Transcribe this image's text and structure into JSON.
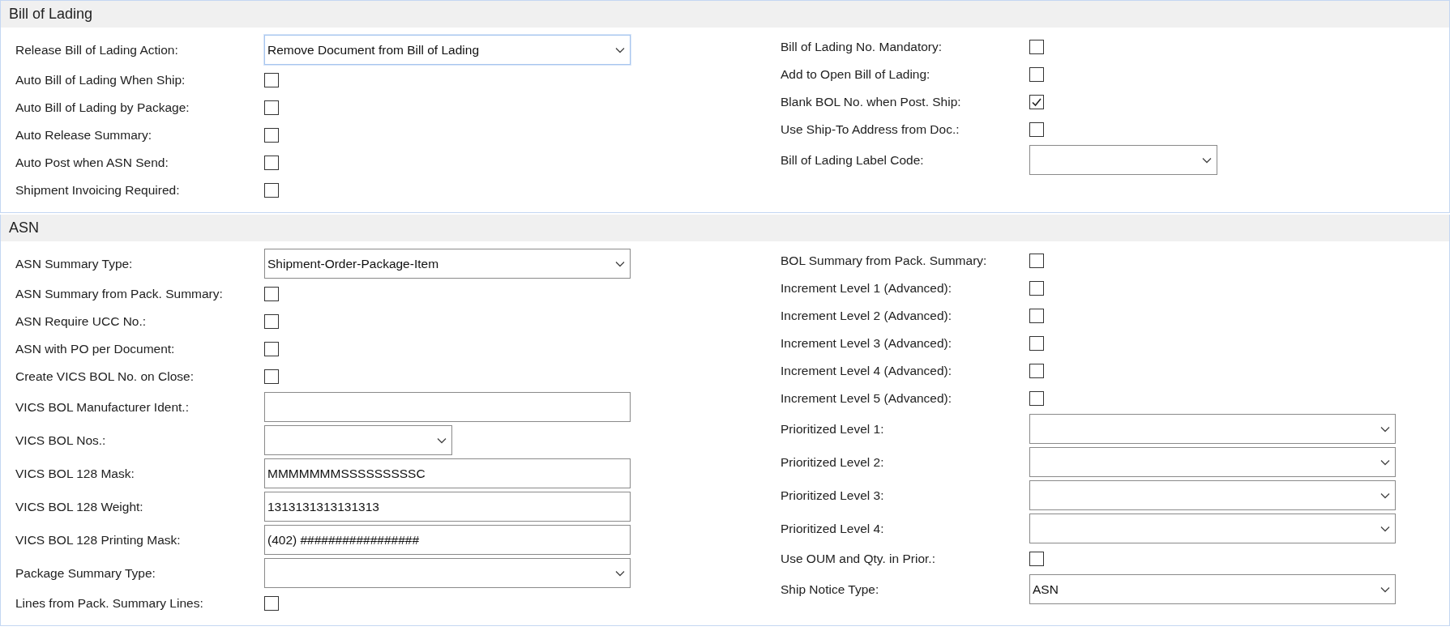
{
  "sections": [
    {
      "title": "Bill of Lading",
      "columns": [
        [
          {
            "kind": "select",
            "label": "Release Bill of Lading Action:",
            "value": "Remove Document from Bill of Lading",
            "focused": true
          },
          {
            "kind": "checkbox",
            "label": "Auto Bill of Lading When Ship:",
            "checked": false
          },
          {
            "kind": "checkbox",
            "label": "Auto Bill of Lading by Package:",
            "checked": false
          },
          {
            "kind": "checkbox",
            "label": "Auto Release Summary:",
            "checked": false
          },
          {
            "kind": "checkbox",
            "label": "Auto Post when ASN Send:",
            "checked": false
          },
          {
            "kind": "checkbox",
            "label": "Shipment Invoicing Required:",
            "checked": false
          }
        ],
        [
          {
            "kind": "checkbox",
            "label": "Bill of Lading No. Mandatory:",
            "checked": false
          },
          {
            "kind": "checkbox",
            "label": "Add to Open Bill of Lading:",
            "checked": false
          },
          {
            "kind": "checkbox",
            "label": "Blank BOL No. when Post. Ship:",
            "checked": true
          },
          {
            "kind": "checkbox",
            "label": "Use Ship-To Address from Doc.:",
            "checked": false
          },
          {
            "kind": "short-select",
            "label": "Bill of Lading Label Code:"
          }
        ]
      ]
    },
    {
      "title": "ASN",
      "columns": [
        [
          {
            "kind": "select",
            "label": "ASN Summary Type:",
            "value": "Shipment-Order-Package-Item"
          },
          {
            "kind": "checkbox",
            "label": "ASN Summary from Pack. Summary:",
            "checked": false
          },
          {
            "kind": "checkbox",
            "label": "ASN Require UCC No.:",
            "checked": false
          },
          {
            "kind": "checkbox",
            "label": "ASN with PO per Document:",
            "checked": false
          },
          {
            "kind": "checkbox",
            "label": "Create VICS BOL No. on Close:",
            "checked": false
          },
          {
            "kind": "text",
            "label": "VICS BOL Manufacturer Ident.:"
          },
          {
            "kind": "short-select",
            "label": "VICS BOL Nos.:"
          },
          {
            "kind": "text",
            "label": "VICS BOL 128 Mask:",
            "value": "MMMMMMMSSSSSSSSSC"
          },
          {
            "kind": "text",
            "label": "VICS BOL 128 Weight:",
            "value": "1313131313131313"
          },
          {
            "kind": "text",
            "label": "VICS BOL 128 Printing Mask:",
            "value": "(402) #################"
          },
          {
            "kind": "select",
            "label": "Package Summary Type:"
          },
          {
            "kind": "checkbox",
            "label": "Lines from Pack. Summary Lines:",
            "checked": false
          }
        ],
        [
          {
            "kind": "checkbox",
            "label": "BOL Summary from Pack. Summary:",
            "checked": false
          },
          {
            "kind": "checkbox",
            "label": "Increment Level 1 (Advanced):",
            "checked": false
          },
          {
            "kind": "checkbox",
            "label": "Increment Level 2 (Advanced):",
            "checked": false
          },
          {
            "kind": "checkbox",
            "label": "Increment Level 3 (Advanced):",
            "checked": false
          },
          {
            "kind": "checkbox",
            "label": "Increment Level 4 (Advanced):",
            "checked": false
          },
          {
            "kind": "checkbox",
            "label": "Increment Level 5 (Advanced):",
            "checked": false
          },
          {
            "kind": "select",
            "label": "Prioritized Level 1:"
          },
          {
            "kind": "select",
            "label": "Prioritized Level 2:"
          },
          {
            "kind": "select",
            "label": "Prioritized Level 3:"
          },
          {
            "kind": "select",
            "label": "Prioritized Level 4:"
          },
          {
            "kind": "checkbox",
            "label": "Use OUM and Qty. in Prior.:",
            "checked": false
          },
          {
            "kind": "select",
            "label": "Ship Notice Type:",
            "value": "ASN"
          }
        ]
      ]
    }
  ]
}
